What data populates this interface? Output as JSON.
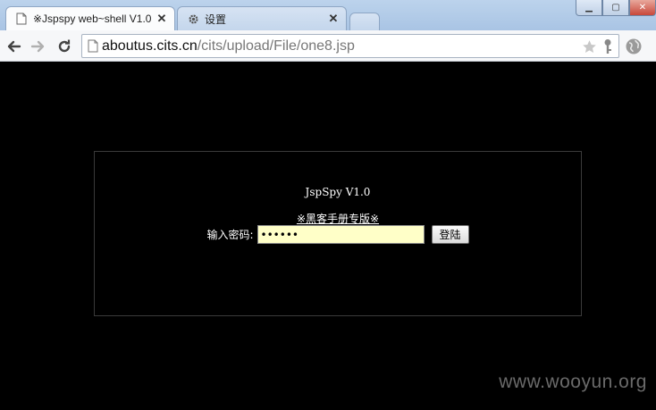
{
  "browser": {
    "tabs": [
      {
        "title": "※Jspspy web~shell V1.0",
        "icon": "page-icon",
        "active": true
      },
      {
        "title": "设置",
        "icon": "gear-icon",
        "active": false
      }
    ],
    "url_host": "aboutus.cits.cn",
    "url_path": "/cits/upload/File/one8.jsp"
  },
  "page": {
    "app_title": "JspSpy V1.0",
    "subtitle": "※黑客手册专版※",
    "password_label": "输入密码:",
    "password_value": "••••••",
    "login_button": "登陆"
  },
  "watermark": "www.wooyun.org",
  "colors": {
    "page_background": "#000000",
    "input_background": "#ffffc8",
    "border": "#3a3a3a"
  }
}
